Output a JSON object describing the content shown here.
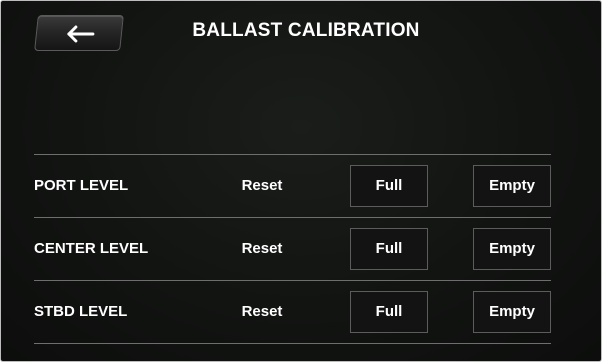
{
  "header": {
    "title": "BALLAST CALIBRATION",
    "back_icon": "left-arrow-icon"
  },
  "rows": [
    {
      "label": "PORT LEVEL",
      "reset": "Reset",
      "full": "Full",
      "empty": "Empty"
    },
    {
      "label": "CENTER LEVEL",
      "reset": "Reset",
      "full": "Full",
      "empty": "Empty"
    },
    {
      "label": "STBD LEVEL",
      "reset": "Reset",
      "full": "Full",
      "empty": "Empty"
    }
  ],
  "colors": {
    "background": "#121412",
    "text": "#ffffff",
    "divider": "#6e6e6e",
    "button_border": "#5c5c5c"
  }
}
